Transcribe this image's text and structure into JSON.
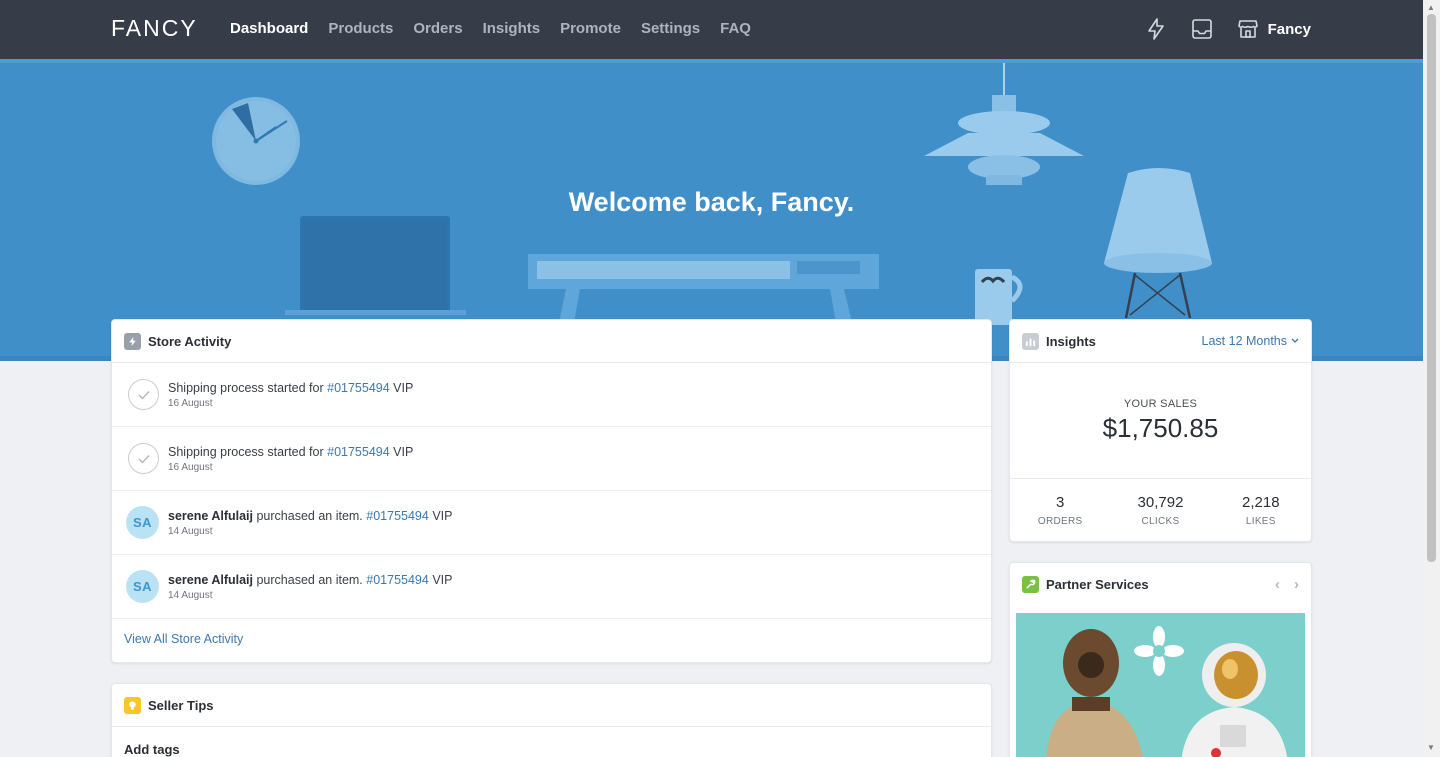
{
  "nav": {
    "logo": "FANCY",
    "items": [
      {
        "label": "Dashboard",
        "active": true
      },
      {
        "label": "Products",
        "active": false
      },
      {
        "label": "Orders",
        "active": false
      },
      {
        "label": "Insights",
        "active": false
      },
      {
        "label": "Promote",
        "active": false
      },
      {
        "label": "Settings",
        "active": false
      },
      {
        "label": "FAQ",
        "active": false
      }
    ],
    "icons": [
      "lightning-icon",
      "inbox-icon",
      "store-icon"
    ],
    "store_name": "Fancy"
  },
  "hero": {
    "title": "Welcome back, Fancy."
  },
  "store_activity": {
    "title": "Store Activity",
    "items": [
      {
        "type": "check",
        "text": "Shipping process started for ",
        "order": "#01755494",
        "suffix": " VIP",
        "date": "16 August"
      },
      {
        "type": "check",
        "text": "Shipping process started for ",
        "order": "#01755494",
        "suffix": " VIP",
        "date": "16 August"
      },
      {
        "type": "avatar",
        "initials": "SA",
        "user": "serene Alfulaij",
        "text": " purchased an item. ",
        "order": "#01755494",
        "suffix": " VIP",
        "date": "14 August"
      },
      {
        "type": "avatar",
        "initials": "SA",
        "user": "serene Alfulaij",
        "text": " purchased an item. ",
        "order": "#01755494",
        "suffix": " VIP",
        "date": "14 August"
      }
    ],
    "view_all": "View All Store Activity"
  },
  "insights": {
    "title": "Insights",
    "period": "Last 12 Months",
    "sales_label": "YOUR SALES",
    "sales_value": "$1,750.85",
    "stats": [
      {
        "value": "3",
        "label": "ORDERS"
      },
      {
        "value": "30,792",
        "label": "CLICKS"
      },
      {
        "value": "2,218",
        "label": "LIKES"
      }
    ]
  },
  "partner_services": {
    "title": "Partner Services",
    "prev": "‹",
    "next": "›"
  },
  "seller_tips": {
    "title": "Seller Tips",
    "first_item": "Add tags"
  },
  "colors": {
    "nav_bg": "#373d48",
    "hero_bg": "#418fc8",
    "link": "#3c78ad",
    "avatar_bg": "#b9e2f5"
  }
}
